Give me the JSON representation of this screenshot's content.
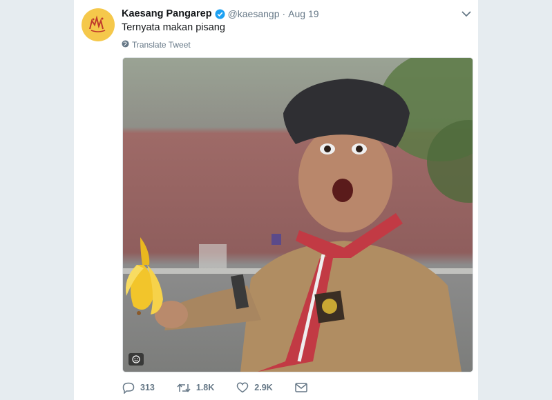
{
  "tweet": {
    "author_name": "Kaesang Pangarep",
    "handle": "@kaesangp",
    "separator": "·",
    "date": "Aug 19",
    "text": "Ternyata makan pisang",
    "translate_label": "Translate Tweet"
  },
  "actions": {
    "replies": "313",
    "retweets": "1.8K",
    "likes": "2.9K"
  },
  "icons": {
    "verified": "verified-badge-icon",
    "caret": "chevron-down-icon",
    "globe": "globe-icon",
    "reply": "reply-icon",
    "retweet": "retweet-icon",
    "like": "heart-icon",
    "dm": "envelope-icon",
    "sticker": "smiley-icon"
  },
  "colors": {
    "accent": "#1da1f2",
    "muted": "#657786",
    "avatar_bg": "#f5c84b"
  }
}
